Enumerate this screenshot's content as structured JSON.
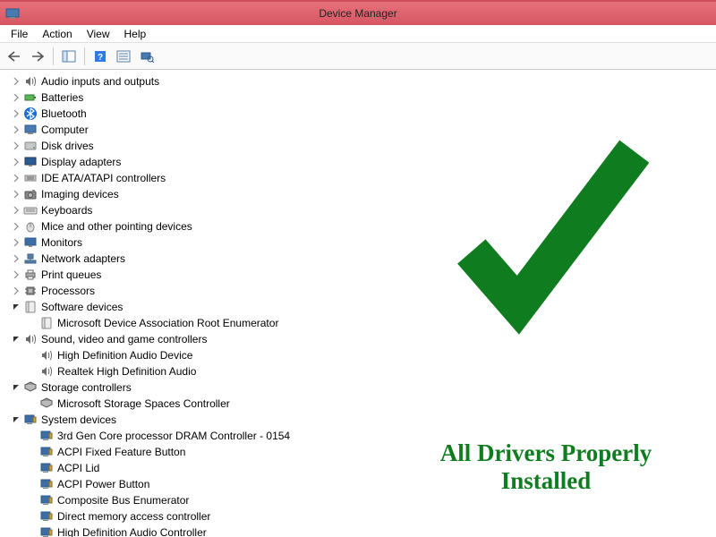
{
  "window": {
    "title": "Device Manager"
  },
  "menus": {
    "file": "File",
    "action": "Action",
    "view": "View",
    "help": "Help"
  },
  "tree": [
    {
      "label": "Audio inputs and outputs",
      "icon": "speaker",
      "expanded": false,
      "children": []
    },
    {
      "label": "Batteries",
      "icon": "battery",
      "expanded": false,
      "children": []
    },
    {
      "label": "Bluetooth",
      "icon": "bluetooth",
      "expanded": false,
      "children": []
    },
    {
      "label": "Computer",
      "icon": "computer",
      "expanded": false,
      "children": []
    },
    {
      "label": "Disk drives",
      "icon": "disk",
      "expanded": false,
      "children": []
    },
    {
      "label": "Display adapters",
      "icon": "display",
      "expanded": false,
      "children": []
    },
    {
      "label": "IDE ATA/ATAPI controllers",
      "icon": "ide",
      "expanded": false,
      "children": []
    },
    {
      "label": "Imaging devices",
      "icon": "camera",
      "expanded": false,
      "children": []
    },
    {
      "label": "Keyboards",
      "icon": "keyboard",
      "expanded": false,
      "children": []
    },
    {
      "label": "Mice and other pointing devices",
      "icon": "mouse",
      "expanded": false,
      "children": []
    },
    {
      "label": "Monitors",
      "icon": "monitor",
      "expanded": false,
      "children": []
    },
    {
      "label": "Network adapters",
      "icon": "network",
      "expanded": false,
      "children": []
    },
    {
      "label": "Print queues",
      "icon": "printer",
      "expanded": false,
      "children": []
    },
    {
      "label": "Processors",
      "icon": "cpu",
      "expanded": false,
      "children": []
    },
    {
      "label": "Software devices",
      "icon": "software",
      "expanded": true,
      "children": [
        {
          "label": "Microsoft Device Association Root Enumerator",
          "icon": "software"
        }
      ]
    },
    {
      "label": "Sound, video and game controllers",
      "icon": "speaker",
      "expanded": true,
      "children": [
        {
          "label": "High Definition Audio Device",
          "icon": "speaker"
        },
        {
          "label": "Realtek High Definition Audio",
          "icon": "speaker"
        }
      ]
    },
    {
      "label": "Storage controllers",
      "icon": "storage",
      "expanded": true,
      "children": [
        {
          "label": "Microsoft Storage Spaces Controller",
          "icon": "storage"
        }
      ]
    },
    {
      "label": "System devices",
      "icon": "system",
      "expanded": true,
      "children": [
        {
          "label": "3rd Gen Core processor DRAM Controller - 0154",
          "icon": "system"
        },
        {
          "label": "ACPI Fixed Feature Button",
          "icon": "system"
        },
        {
          "label": "ACPI Lid",
          "icon": "system"
        },
        {
          "label": "ACPI Power Button",
          "icon": "system"
        },
        {
          "label": "Composite Bus Enumerator",
          "icon": "system"
        },
        {
          "label": "Direct memory access controller",
          "icon": "system"
        },
        {
          "label": "High Definition Audio Controller",
          "icon": "system"
        }
      ]
    }
  ],
  "overlay": {
    "text": "All Drivers Properly Installed"
  },
  "colors": {
    "check": "#0f7d1f",
    "titlebar": "#dc5f6b"
  }
}
